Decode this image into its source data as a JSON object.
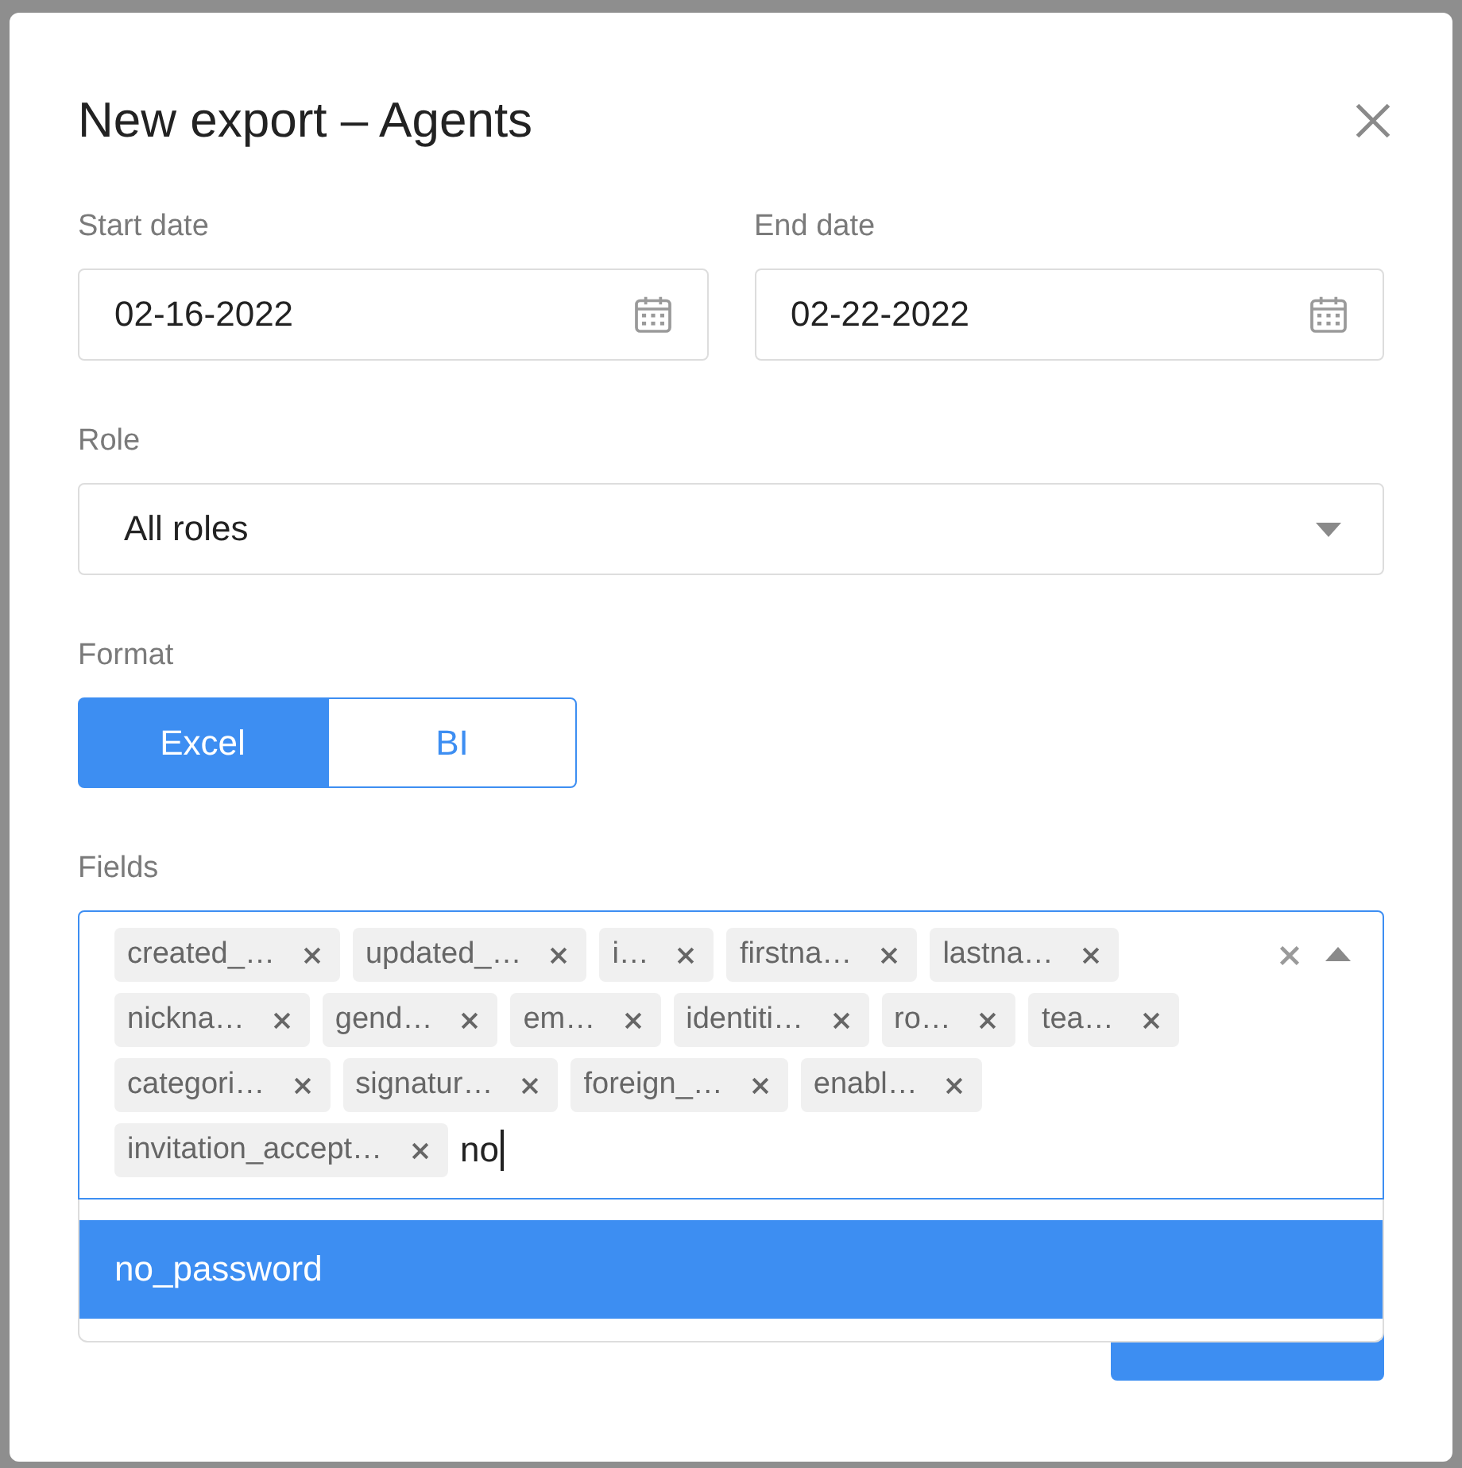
{
  "dialog": {
    "title": "New export – Agents"
  },
  "start_date": {
    "label": "Start date",
    "value": "02-16-2022"
  },
  "end_date": {
    "label": "End date",
    "value": "02-22-2022"
  },
  "role": {
    "label": "Role",
    "value": "All roles"
  },
  "format": {
    "label": "Format",
    "options": [
      {
        "label": "Excel",
        "selected": true
      },
      {
        "label": "BI",
        "selected": false
      }
    ]
  },
  "fields": {
    "label": "Fields",
    "expanded": true,
    "tags": [
      "created_…",
      "updated_…",
      "i…",
      "firstna…",
      "lastna…",
      "nickna…",
      "gend…",
      "em…",
      "identiti…",
      "ro…",
      "tea…",
      "categori…",
      "signatur…",
      "foreign_…",
      "enabl…",
      "invitation_accept…"
    ],
    "query": "no",
    "options": [
      {
        "label": "no_password",
        "selected": true
      }
    ]
  }
}
